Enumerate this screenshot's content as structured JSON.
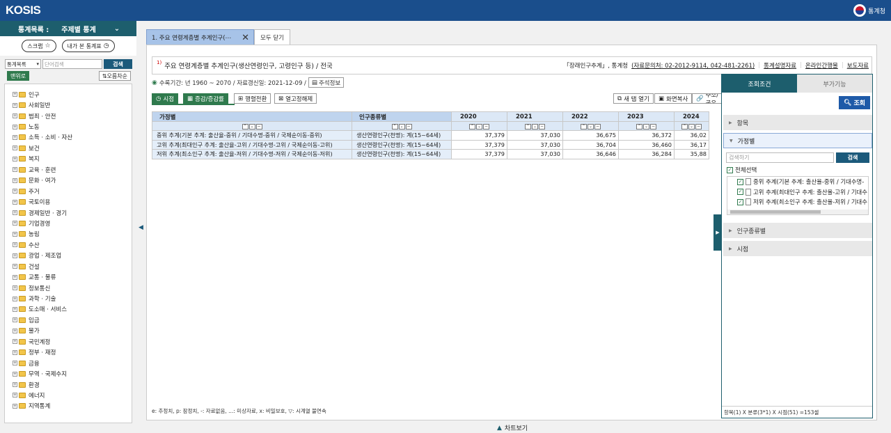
{
  "header": {
    "logo": "KOSIS",
    "agency": "통계청"
  },
  "sidebar": {
    "head_label": "통계목록 :",
    "head_value": "주제별 통계",
    "scrap_label": "스크랩",
    "my_stats_label": "내가 본 통계표",
    "search_select": "통계목록",
    "search_placeholder": "단어검색",
    "search_button": "검색",
    "menu_button": "맨위로",
    "sort_button": "오름차순",
    "tree": [
      "인구",
      "사회일반",
      "범죄 · 안전",
      "노동",
      "소득 · 소비 · 자산",
      "보건",
      "복지",
      "교육 · 훈련",
      "문화 · 여가",
      "주거",
      "국토이용",
      "경제일반 · 경기",
      "기업경영",
      "농림",
      "수산",
      "광업 · 제조업",
      "건설",
      "교통 · 물류",
      "정보통신",
      "과학 · 기술",
      "도소매 · 서비스",
      "임금",
      "물가",
      "국민계정",
      "정부 · 재정",
      "금융",
      "무역 · 국제수지",
      "환경",
      "에너지",
      "지역통계"
    ]
  },
  "tabs": {
    "active": "1. 주요 연령계층별 추계인구(⋯",
    "close_all": "모두 닫기"
  },
  "title": {
    "sup": "1)",
    "text": "주요 연령계층별 추계인구(생산연령인구, 고령인구 등) / 전국",
    "source_prefix": "「장래인구추계」, 통계청",
    "contact": "(자료문의처: 02-2012-9114, 042-481-2261)",
    "link1": "통계설명자료",
    "link2": "온라인간행물",
    "link3": "보도자료"
  },
  "meta": {
    "period": "수록기간: 년 1960 ~ 2070 / 자료갱신일: 2021-12-09 /",
    "note_button": "주석정보"
  },
  "toolbar": {
    "time": "시점",
    "increase": "증감/증감률",
    "pivot": "행렬전환",
    "hide_cols": "열고정해제",
    "new_tab": "새 탭 열기",
    "copy": "화면복사",
    "url": "주소/공유"
  },
  "grid": {
    "col_scenario": "가정별",
    "col_type": "인구종류별",
    "years": [
      "2020",
      "2021",
      "2022",
      "2023",
      "2024"
    ],
    "rows": [
      {
        "scenario": "중위 추계(기본 추계: 출산율-중위 / 기대수명-중위 / 국제순이동-중위)",
        "type": "생산연령인구(천명): 계(15~64세)",
        "values": [
          "37,379",
          "37,030",
          "36,675",
          "36,372",
          "36,02"
        ]
      },
      {
        "scenario": "고위 추계(최대인구 추계: 출산율-고위 / 기대수명-고위 / 국제순이동-고위)",
        "type": "생산연령인구(천명): 계(15~64세)",
        "values": [
          "37,379",
          "37,030",
          "36,704",
          "36,460",
          "36,17"
        ]
      },
      {
        "scenario": "저위 추계(최소인구 추계: 출산율-저위 / 기대수명-저위 / 국제순이동-저위)",
        "type": "생산연령인구(천명): 계(15~64세)",
        "values": [
          "37,379",
          "37,030",
          "36,646",
          "36,284",
          "35,88"
        ]
      }
    ]
  },
  "footnote": "e: 추정치, p: 잠정치, -: 자료없음, ...: 미상자료, x: 비밀보호, ▽: 시계열 불연속",
  "chart_view": "차트보기",
  "panel": {
    "tab_query": "조회조건",
    "tab_extra": "부가기능",
    "query_button": "조회",
    "sec_item": "항목",
    "sec_scenario": "가정별",
    "search_placeholder": "검색하기",
    "search_button": "검색",
    "select_all": "전체선택",
    "list": [
      "중위 추계(기본 추계: 출산율-중위 / 기대수명-",
      "고위 추계(최대인구 추계: 출산율-고위 / 기대수",
      "저위 추계(최소인구 추계: 출산율-저위 / 기대수"
    ],
    "sec_type": "인구종류별",
    "sec_time": "시점",
    "summary": "항목(1) X 분류(3*1) X 시점(51) =153셀"
  }
}
